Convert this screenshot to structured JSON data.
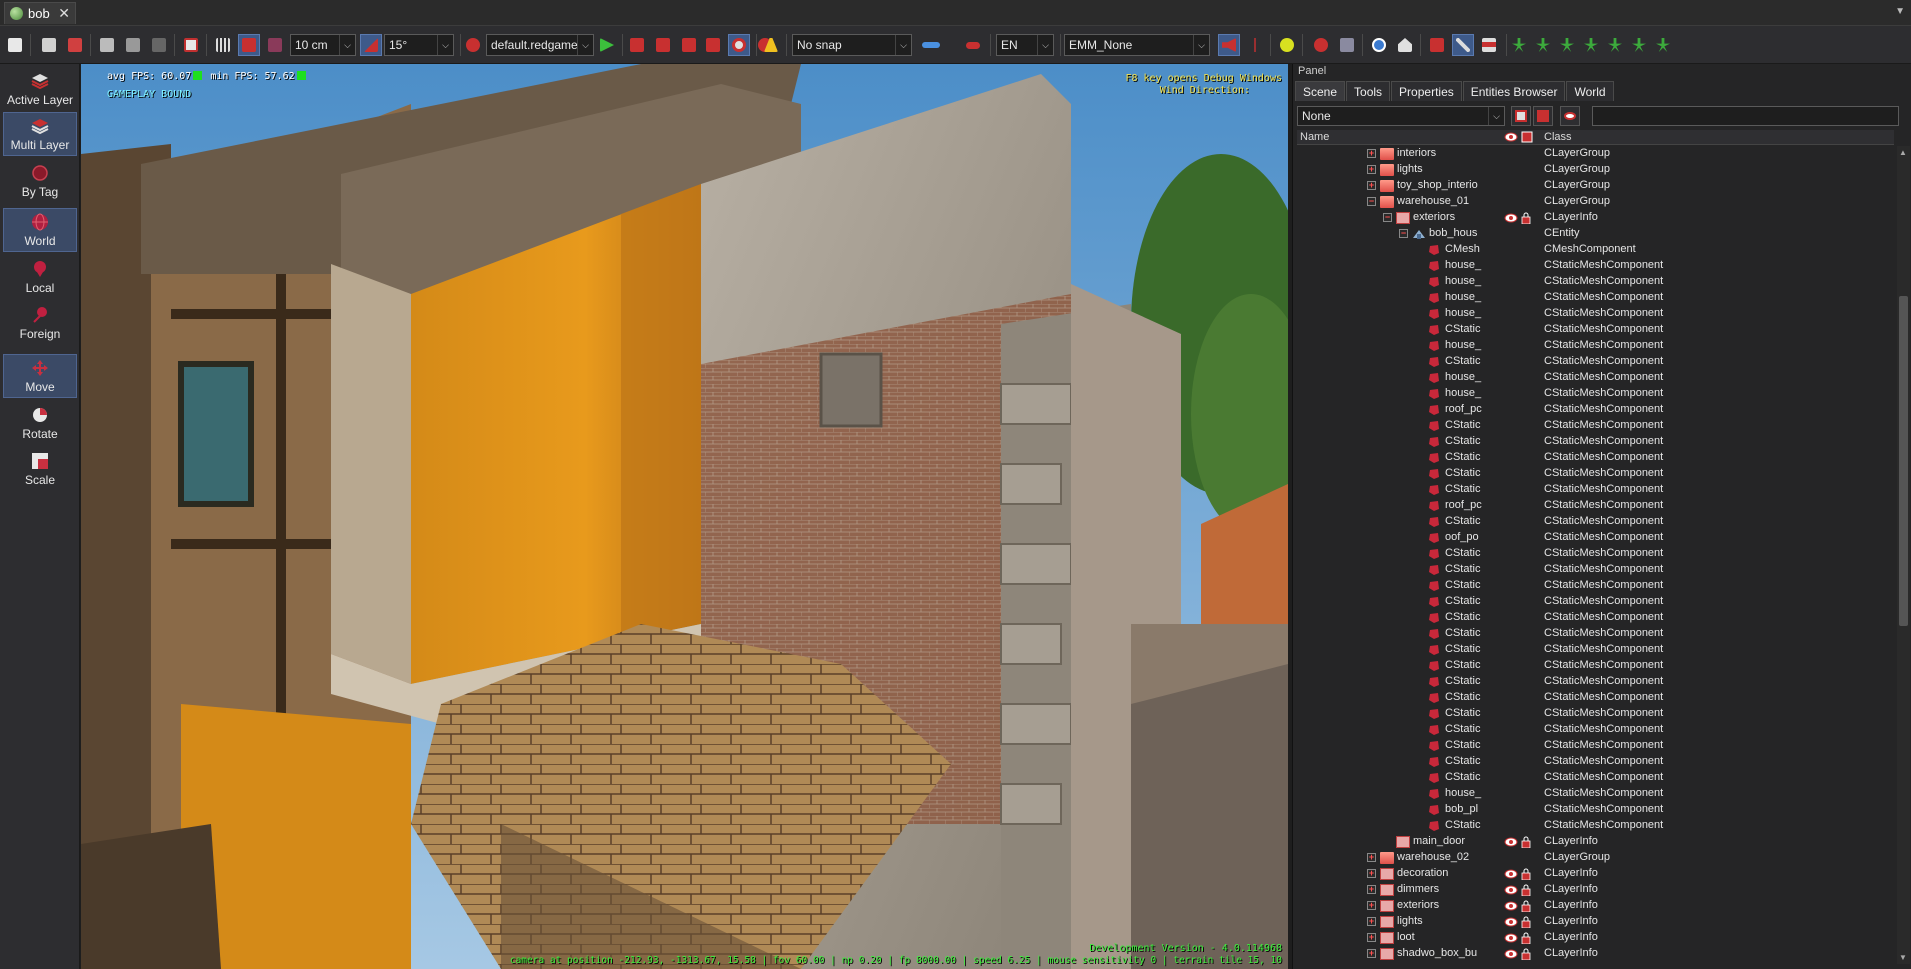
{
  "tab": {
    "title": "bob",
    "close": "✕",
    "menu_glyph": "▼"
  },
  "toolbar": {
    "grid_step": "10 cm",
    "angle_step": "15°",
    "game_definition": "default.redgame",
    "snap_mode": "No snap",
    "language": "EN",
    "env_preset": "EMM_None",
    "combo_arrow": "⌵"
  },
  "left_toolbar": {
    "buttons": [
      {
        "label": "Active Layer",
        "active": false
      },
      {
        "label": "Multi Layer",
        "active": true
      },
      {
        "label": "By Tag",
        "active": false
      },
      {
        "label": "World",
        "active": true
      },
      {
        "label": "Local",
        "active": false
      },
      {
        "label": "Foreign",
        "active": false
      },
      {
        "label": "Move",
        "active": true
      },
      {
        "label": "Rotate",
        "active": false
      },
      {
        "label": "Scale",
        "active": false
      }
    ]
  },
  "viewport": {
    "fps_avg": "avg FPS: 60.07",
    "fps_min": "min FPS: 57.62",
    "gameplay_bound": "GAMEPLAY BOUND",
    "debug_hint": "F8 key opens Debug Windows",
    "wind": "Wind Direction:",
    "dev_version": "Development Version - 4.0.114968",
    "camera_status": "camera at position -212.93, -1313.67, 15.58 | fov 60.00 | np 0.20 | fp 8000.00 | speed 6.25 | mouse sensitivity 0 | terrain tile 15, 10"
  },
  "panel": {
    "title": "Panel",
    "tabs": [
      {
        "label": "Scene",
        "active": true
      },
      {
        "label": "Tools",
        "active": false
      },
      {
        "label": "Properties",
        "active": false
      },
      {
        "label": "Entities Browser",
        "active": false
      },
      {
        "label": "World",
        "active": false
      }
    ],
    "filter_value": "None",
    "col_name": "Name",
    "col_class": "Class",
    "rows": [
      {
        "name": "interiors",
        "cls": "CLayerGroup",
        "indent": 0,
        "exp": "+",
        "icon": "folder"
      },
      {
        "name": "lights",
        "cls": "CLayerGroup",
        "indent": 0,
        "exp": "+",
        "icon": "folder"
      },
      {
        "name": "toy_shop_interio",
        "cls": "CLayerGroup",
        "indent": 0,
        "exp": "+",
        "icon": "folder"
      },
      {
        "name": "warehouse_01",
        "cls": "CLayerGroup",
        "indent": 0,
        "exp": "−",
        "icon": "folder"
      },
      {
        "name": "exteriors",
        "cls": "CLayerInfo",
        "indent": 1,
        "exp": "−",
        "icon": "layer",
        "vis": true
      },
      {
        "name": "bob_hous",
        "cls": "CEntity",
        "indent": 2,
        "exp": "−",
        "icon": "entity"
      },
      {
        "name": "CMesh",
        "cls": "CMeshComponent",
        "indent": 3,
        "icon": "comp"
      },
      {
        "name": "house_",
        "cls": "CStaticMeshComponent",
        "indent": 3,
        "icon": "comp"
      },
      {
        "name": "house_",
        "cls": "CStaticMeshComponent",
        "indent": 3,
        "icon": "comp"
      },
      {
        "name": "house_",
        "cls": "CStaticMeshComponent",
        "indent": 3,
        "icon": "comp"
      },
      {
        "name": "house_",
        "cls": "CStaticMeshComponent",
        "indent": 3,
        "icon": "comp"
      },
      {
        "name": "CStatic",
        "cls": "CStaticMeshComponent",
        "indent": 3,
        "icon": "comp"
      },
      {
        "name": "house_",
        "cls": "CStaticMeshComponent",
        "indent": 3,
        "icon": "comp"
      },
      {
        "name": "CStatic",
        "cls": "CStaticMeshComponent",
        "indent": 3,
        "icon": "comp"
      },
      {
        "name": "house_",
        "cls": "CStaticMeshComponent",
        "indent": 3,
        "icon": "comp"
      },
      {
        "name": "house_",
        "cls": "CStaticMeshComponent",
        "indent": 3,
        "icon": "comp"
      },
      {
        "name": "roof_pc",
        "cls": "CStaticMeshComponent",
        "indent": 3,
        "icon": "comp"
      },
      {
        "name": "CStatic",
        "cls": "CStaticMeshComponent",
        "indent": 3,
        "icon": "comp"
      },
      {
        "name": "CStatic",
        "cls": "CStaticMeshComponent",
        "indent": 3,
        "icon": "comp"
      },
      {
        "name": "CStatic",
        "cls": "CStaticMeshComponent",
        "indent": 3,
        "icon": "comp"
      },
      {
        "name": "CStatic",
        "cls": "CStaticMeshComponent",
        "indent": 3,
        "icon": "comp"
      },
      {
        "name": "CStatic",
        "cls": "CStaticMeshComponent",
        "indent": 3,
        "icon": "comp"
      },
      {
        "name": "roof_pc",
        "cls": "CStaticMeshComponent",
        "indent": 3,
        "icon": "comp"
      },
      {
        "name": "CStatic",
        "cls": "CStaticMeshComponent",
        "indent": 3,
        "icon": "comp"
      },
      {
        "name": "oof_po",
        "cls": "CStaticMeshComponent",
        "indent": 3,
        "icon": "comp"
      },
      {
        "name": "CStatic",
        "cls": "CStaticMeshComponent",
        "indent": 3,
        "icon": "comp"
      },
      {
        "name": "CStatic",
        "cls": "CStaticMeshComponent",
        "indent": 3,
        "icon": "comp"
      },
      {
        "name": "CStatic",
        "cls": "CStaticMeshComponent",
        "indent": 3,
        "icon": "comp"
      },
      {
        "name": "CStatic",
        "cls": "CStaticMeshComponent",
        "indent": 3,
        "icon": "comp"
      },
      {
        "name": "CStatic",
        "cls": "CStaticMeshComponent",
        "indent": 3,
        "icon": "comp"
      },
      {
        "name": "CStatic",
        "cls": "CStaticMeshComponent",
        "indent": 3,
        "icon": "comp"
      },
      {
        "name": "CStatic",
        "cls": "CStaticMeshComponent",
        "indent": 3,
        "icon": "comp"
      },
      {
        "name": "CStatic",
        "cls": "CStaticMeshComponent",
        "indent": 3,
        "icon": "comp"
      },
      {
        "name": "CStatic",
        "cls": "CStaticMeshComponent",
        "indent": 3,
        "icon": "comp"
      },
      {
        "name": "CStatic",
        "cls": "CStaticMeshComponent",
        "indent": 3,
        "icon": "comp"
      },
      {
        "name": "CStatic",
        "cls": "CStaticMeshComponent",
        "indent": 3,
        "icon": "comp"
      },
      {
        "name": "CStatic",
        "cls": "CStaticMeshComponent",
        "indent": 3,
        "icon": "comp"
      },
      {
        "name": "CStatic",
        "cls": "CStaticMeshComponent",
        "indent": 3,
        "icon": "comp"
      },
      {
        "name": "CStatic",
        "cls": "CStaticMeshComponent",
        "indent": 3,
        "icon": "comp"
      },
      {
        "name": "CStatic",
        "cls": "CStaticMeshComponent",
        "indent": 3,
        "icon": "comp"
      },
      {
        "name": "house_",
        "cls": "CStaticMeshComponent",
        "indent": 3,
        "icon": "comp"
      },
      {
        "name": "bob_pl",
        "cls": "CStaticMeshComponent",
        "indent": 3,
        "icon": "comp"
      },
      {
        "name": "CStatic",
        "cls": "CStaticMeshComponent",
        "indent": 3,
        "icon": "comp"
      },
      {
        "name": "main_door",
        "cls": "CLayerInfo",
        "indent": 1,
        "icon": "layer",
        "vis": true
      },
      {
        "name": "warehouse_02",
        "cls": "CLayerGroup",
        "indent": 0,
        "exp": "+",
        "icon": "folder"
      },
      {
        "name": "decoration",
        "cls": "CLayerInfo",
        "indent": 0,
        "exp": "+",
        "icon": "layer",
        "vis": true
      },
      {
        "name": "dimmers",
        "cls": "CLayerInfo",
        "indent": 0,
        "exp": "+",
        "icon": "layer",
        "vis": true
      },
      {
        "name": "exteriors",
        "cls": "CLayerInfo",
        "indent": 0,
        "exp": "+",
        "icon": "layer",
        "vis": true
      },
      {
        "name": "lights",
        "cls": "CLayerInfo",
        "indent": 0,
        "exp": "+",
        "icon": "layer",
        "vis": true
      },
      {
        "name": "loot",
        "cls": "CLayerInfo",
        "indent": 0,
        "exp": "+",
        "icon": "layer",
        "vis": true
      },
      {
        "name": "shadwo_box_bu",
        "cls": "CLayerInfo",
        "indent": 0,
        "exp": "+",
        "icon": "layer",
        "vis": true
      }
    ]
  }
}
